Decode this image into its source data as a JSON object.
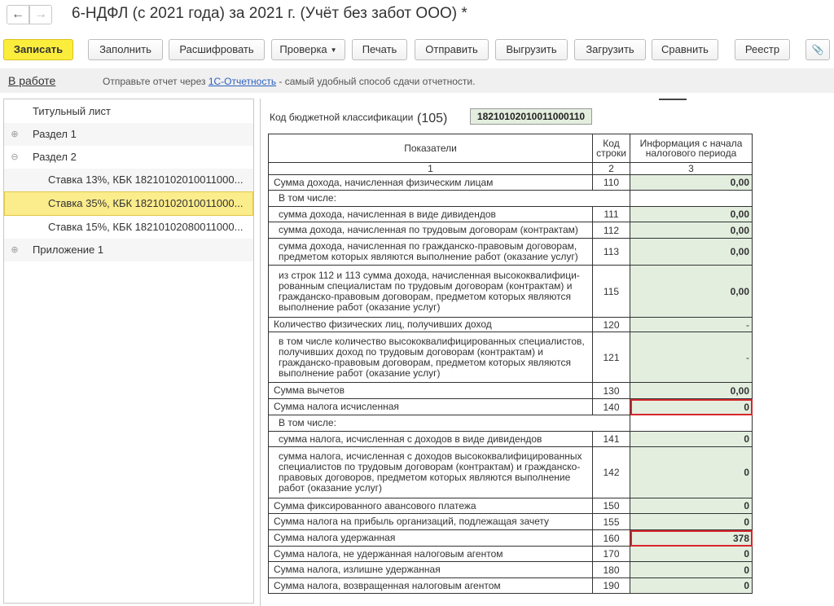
{
  "window": {
    "title": "6-НДФЛ (с 2021 года) за 2021 г. (Учёт без забот ООО) *",
    "back_icon": "←",
    "forward_icon": "→"
  },
  "toolbar": {
    "save": "Записать",
    "fill": "Заполнить",
    "decode": "Расшифровать",
    "check": "Проверка",
    "print": "Печать",
    "send": "Отправить",
    "export": "Выгрузить",
    "import": "Загрузить",
    "compare": "Сравнить",
    "registry": "Реестр",
    "attach_icon": "📎"
  },
  "infobar": {
    "status": "В работе",
    "text_before": "Отправьте отчет через ",
    "link": "1С-Отчетность",
    "text_after": " - самый удобный способ сдачи отчетности."
  },
  "tree": [
    {
      "label": "Титульный лист",
      "icon": ""
    },
    {
      "label": "Раздел 1",
      "icon": "⊕"
    },
    {
      "label": "Раздел 2",
      "icon": "⊖"
    },
    {
      "label": "Ставка 13%, КБК 18210102010011000...",
      "icon": ""
    },
    {
      "label": "Ставка 35%, КБК 18210102010011000...",
      "icon": ""
    },
    {
      "label": "Ставка 15%, КБК 18210102080011000...",
      "icon": ""
    },
    {
      "label": "Приложение 1",
      "icon": "⊕"
    }
  ],
  "form": {
    "kbk_label": "Код бюджетной классификации",
    "kbk_code": "(105)",
    "kbk_value": "18210102010011000110",
    "header": {
      "col1": "Показатели",
      "col2": "Код строки",
      "col3": "Информация с начала налогового периода",
      "n1": "1",
      "n2": "2",
      "n3": "3"
    },
    "rows": [
      {
        "name": "Сумма дохода, начисленная физическим лицам",
        "code": "110",
        "value": "0,00"
      },
      {
        "name": "В том числе:"
      },
      {
        "name": "сумма дохода, начисленная в виде дивидендов",
        "code": "111",
        "value": "0,00"
      },
      {
        "name": "сумма дохода, начисленная по трудовым договорам (контрактам)",
        "code": "112",
        "value": "0,00"
      },
      {
        "name": "сумма дохода, начисленная по гражданско-правовым договорам, предметом которых являются выполнение работ (оказание услуг)",
        "code": "113",
        "value": "0,00"
      },
      {
        "name": "из строк 112 и 113 сумма дохода, начисленная высококвалифици-рованным специалистам по трудовым договорам (контрактам) и гражданско-правовым договорам, предметом которых являются выполнение работ (оказание услуг)",
        "code": "115",
        "value": "0,00"
      },
      {
        "name": "Количество физических лиц, получивших доход",
        "code": "120",
        "value": "-"
      },
      {
        "name": "в том числе количество высококвалифицированных специалистов, получивших доход по трудовым договорам (контрактам) и гражданско-правовым договорам, предметом которых являются выполнение работ (оказание услуг)",
        "code": "121",
        "value": "-"
      },
      {
        "name": "Сумма вычетов",
        "code": "130",
        "value": "0,00"
      },
      {
        "name": "Сумма налога исчисленная",
        "code": "140",
        "value": "0"
      },
      {
        "name": "В том числе:"
      },
      {
        "name": "сумма налога, исчисленная с доходов в виде дивидендов",
        "code": "141",
        "value": "0"
      },
      {
        "name": "сумма налога, исчисленная с доходов высококвалифицированных специалистов по трудовым договорам (контрактам) и гражданско-правовых договоров, предметом которых являются выполнение работ (оказание услуг)",
        "code": "142",
        "value": "0"
      },
      {
        "name": "Сумма фиксированного авансового платежа",
        "code": "150",
        "value": "0"
      },
      {
        "name": "Сумма налога на прибыль организаций, подлежащая зачету",
        "code": "155",
        "value": "0"
      },
      {
        "name": "Сумма налога удержанная",
        "code": "160",
        "value": "378"
      },
      {
        "name": "Сумма налога, не удержанная налоговым агентом",
        "code": "170",
        "value": "0"
      },
      {
        "name": "Сумма налога, излишне удержанная",
        "code": "180",
        "value": "0"
      },
      {
        "name": "Сумма налога, возвращенная налоговым агентом",
        "code": "190",
        "value": "0"
      }
    ]
  }
}
